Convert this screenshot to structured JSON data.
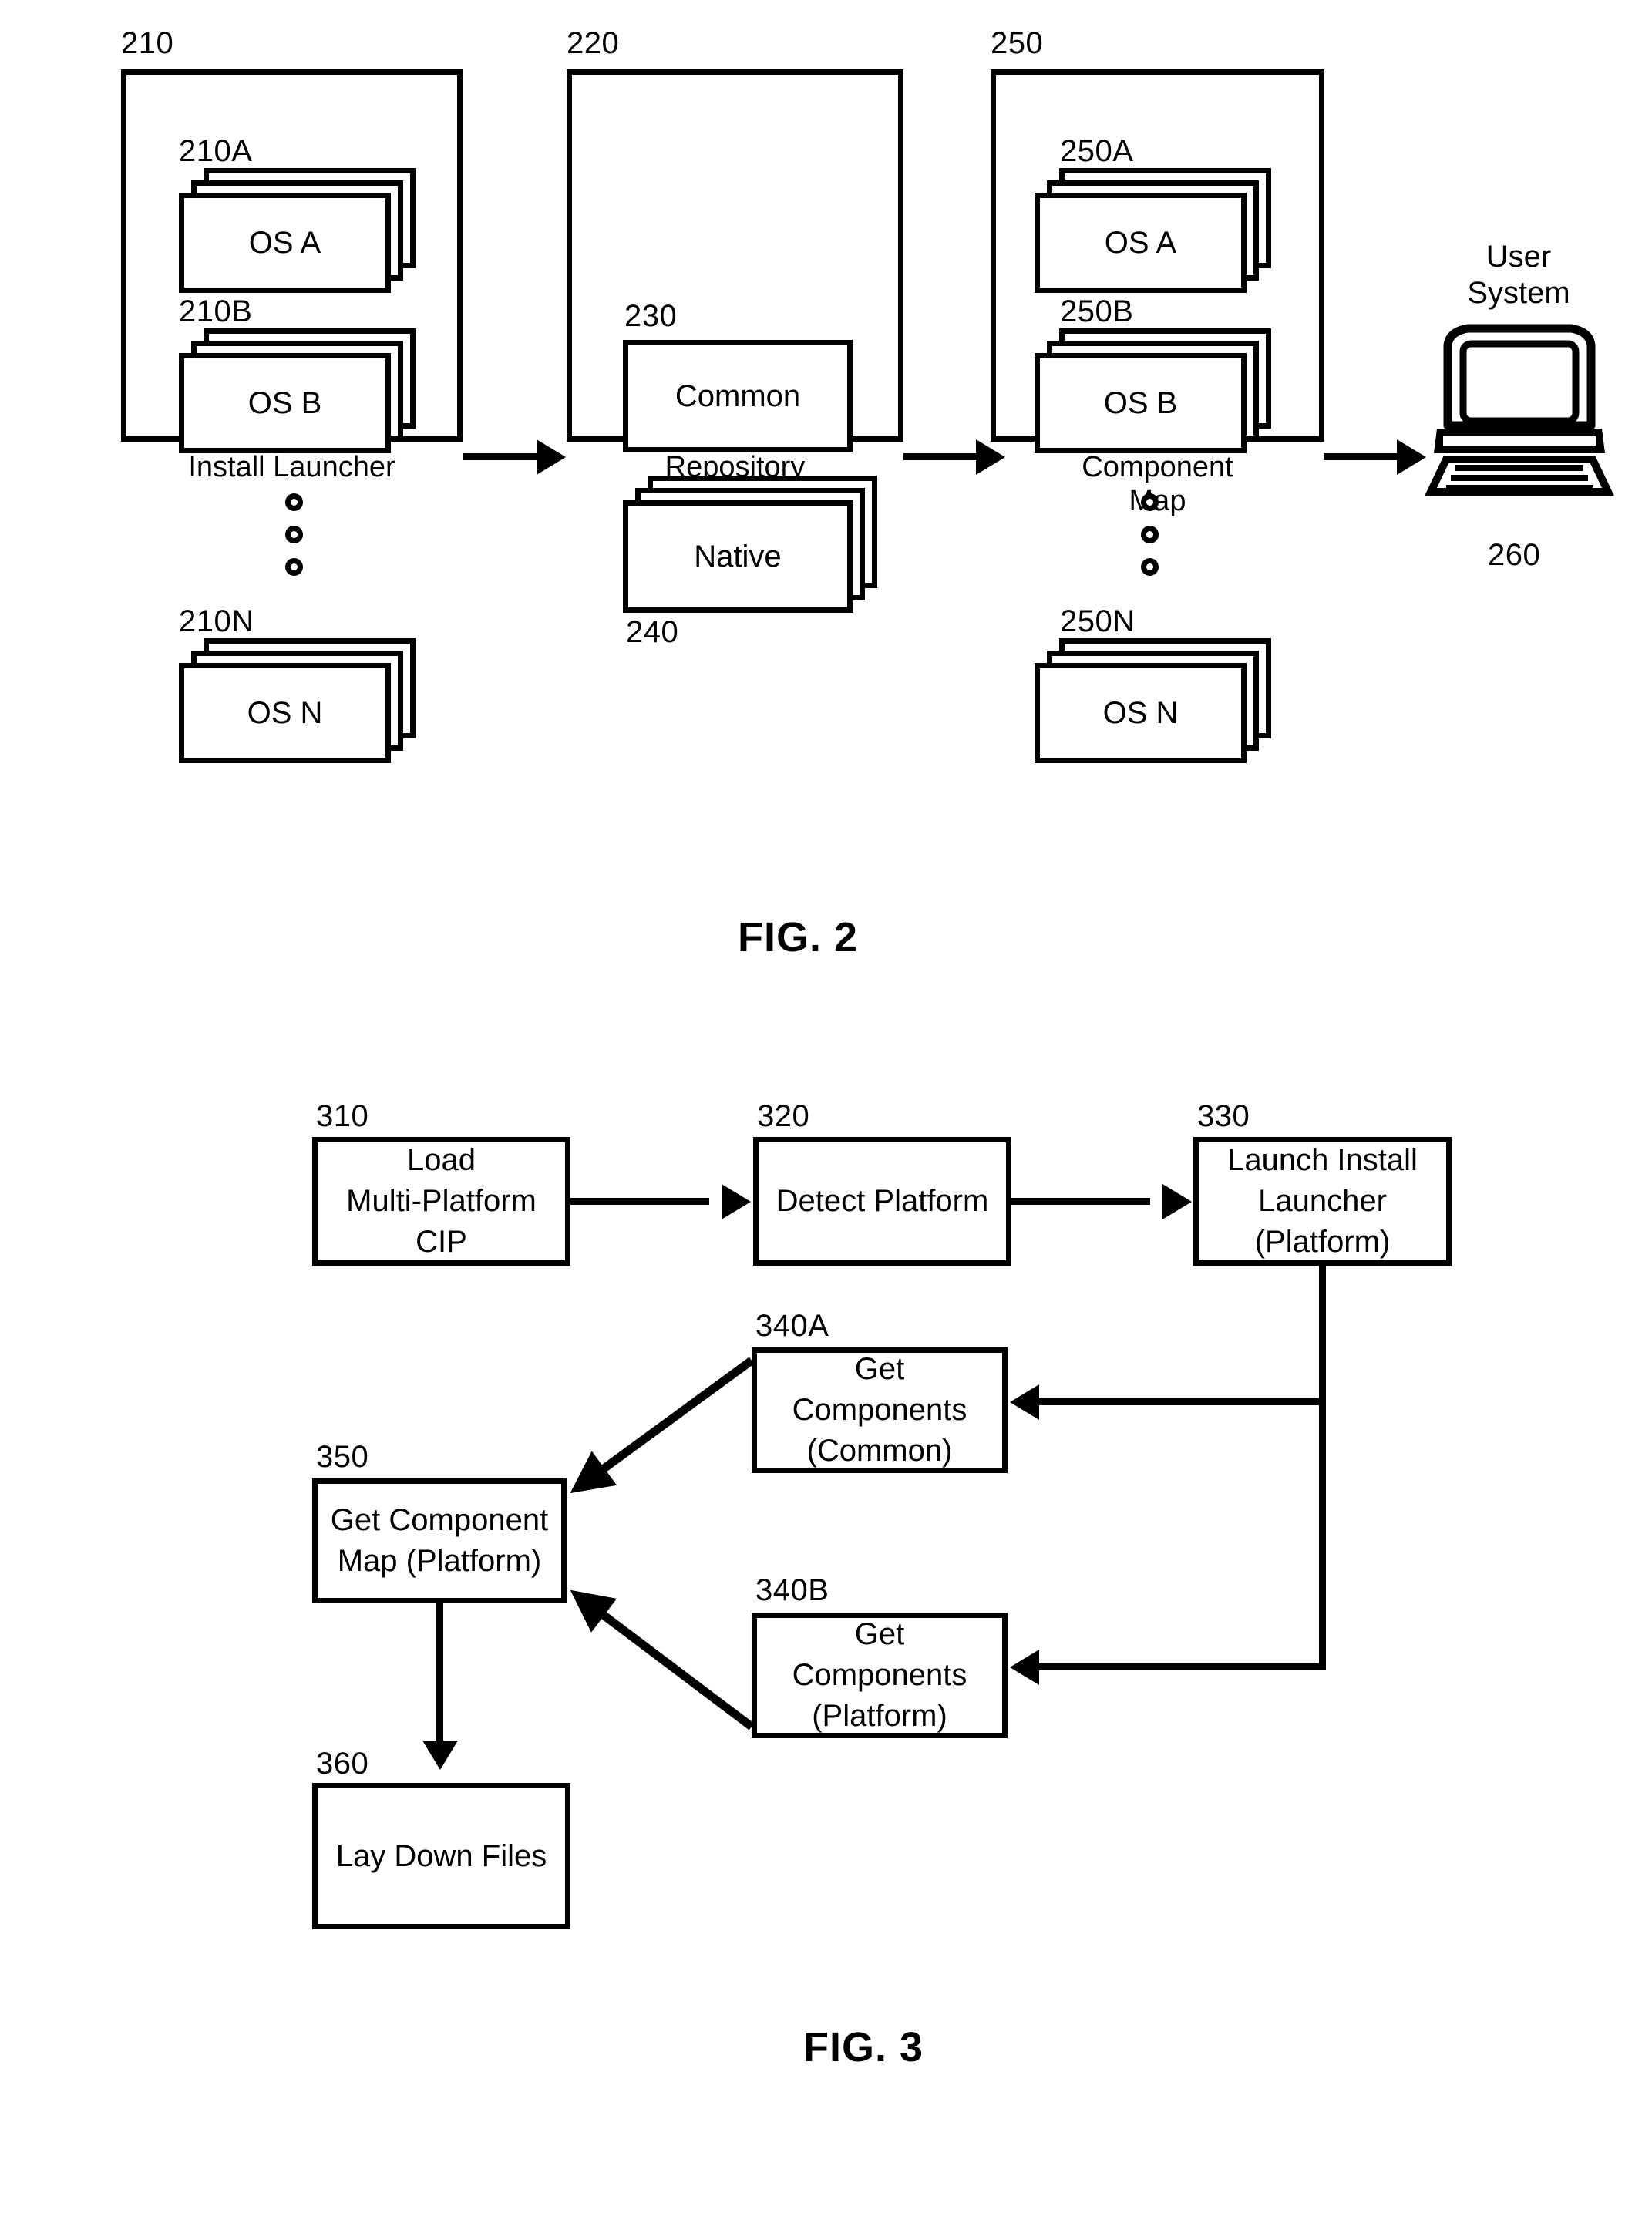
{
  "figures": [
    {
      "id": "fig2",
      "caption": "FIG. 2",
      "containers": [
        {
          "ref": "210",
          "label": "Install Launcher"
        },
        {
          "ref": "220",
          "label": "Repository"
        },
        {
          "ref": "250",
          "label": "Component\nMap"
        }
      ],
      "install_launcher": {
        "ref": "210",
        "label": "Install Launcher",
        "items": [
          {
            "ref": "210A",
            "text": "OS A",
            "stacked": true
          },
          {
            "ref": "210B",
            "text": "OS B",
            "stacked": true
          },
          {
            "ref": "210N",
            "text": "OS N",
            "stacked": true
          }
        ],
        "ellipsis": "vertical-dots"
      },
      "repository": {
        "ref": "220",
        "label": "Repository",
        "items": [
          {
            "ref": "230",
            "text": "Common",
            "stacked": false
          },
          {
            "ref": "240",
            "text": "Native",
            "stacked": true
          }
        ]
      },
      "component_map": {
        "ref": "250",
        "label": "Component\nMap",
        "items": [
          {
            "ref": "250A",
            "text": "OS A",
            "stacked": true
          },
          {
            "ref": "250B",
            "text": "OS B",
            "stacked": true
          },
          {
            "ref": "250N",
            "text": "OS N",
            "stacked": true
          }
        ],
        "ellipsis": "vertical-dots"
      },
      "user_system": {
        "ref": "260",
        "label": "User\nSystem",
        "icon": "laptop-computer-icon"
      },
      "flow_arrows": [
        {
          "from": "210",
          "to": "220",
          "direction": "right"
        },
        {
          "from": "220",
          "to": "250",
          "direction": "right"
        },
        {
          "from": "250",
          "to": "260",
          "direction": "right"
        }
      ]
    },
    {
      "id": "fig3",
      "caption": "FIG. 3",
      "steps": [
        {
          "ref": "310",
          "text": "Load\nMulti-Platform\nCIP"
        },
        {
          "ref": "320",
          "text": "Detect Platform"
        },
        {
          "ref": "330",
          "text": "Launch Install\nLauncher\n(Platform)"
        },
        {
          "ref": "340A",
          "text": "Get\nComponents\n(Common)"
        },
        {
          "ref": "340B",
          "text": "Get\nComponents\n(Platform)"
        },
        {
          "ref": "350",
          "text": "Get Component\nMap (Platform)"
        },
        {
          "ref": "360",
          "text": "Lay Down Files"
        }
      ],
      "connections": [
        {
          "from": "310",
          "to": "320",
          "style": "arrow-right"
        },
        {
          "from": "320",
          "to": "330",
          "style": "arrow-right"
        },
        {
          "from": "330",
          "to": "340A",
          "style": "elbow-arrow-left"
        },
        {
          "from": "330",
          "to": "340B",
          "style": "elbow-arrow-left"
        },
        {
          "from": "340A",
          "to": "350",
          "style": "diagonal-arrow"
        },
        {
          "from": "340B",
          "to": "350",
          "style": "diagonal-arrow"
        },
        {
          "from": "350",
          "to": "360",
          "style": "arrow-down"
        }
      ]
    }
  ],
  "colors": {
    "stroke": "#000000",
    "background": "#ffffff"
  }
}
